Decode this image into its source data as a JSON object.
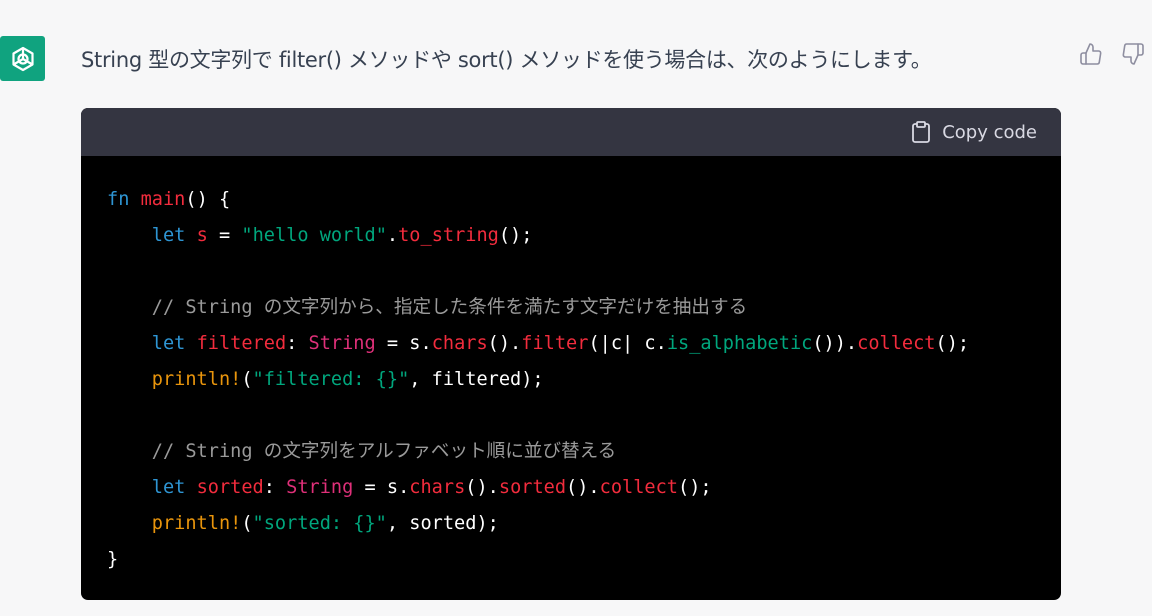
{
  "message": {
    "text": "String 型の文字列で filter() メソッドや sort() メソッドを使う場合は、次のようにします。"
  },
  "feedback": {
    "thumbs_up": "thumbs-up-icon",
    "thumbs_down": "thumbs-down-icon"
  },
  "code_block": {
    "copy_label": "Copy code",
    "lines": {
      "l1_kw": "fn",
      "l1_name": "main",
      "l1_rest": "() {",
      "l2_kw": "let",
      "l2_var": "s",
      "l2_eq": " = ",
      "l2_str": "\"hello world\"",
      "l2_dot": ".",
      "l2_call": "to_string",
      "l2_end": "();",
      "l4_comment": "// String の文字列から、指定した条件を満たす文字だけを抽出する",
      "l5_kw": "let",
      "l5_var": "filtered",
      "l5_colon": ": ",
      "l5_type": "String",
      "l5_eq": " = s.",
      "l5_m1": "chars",
      "l5_p1": "().",
      "l5_m2": "filter",
      "l5_p2": "(|c| c.",
      "l5_m3": "is_alphabetic",
      "l5_p3": "()).",
      "l5_m4": "collect",
      "l5_end": "();",
      "l6_mac": "println!",
      "l6_p1": "(",
      "l6_str": "\"filtered: {}\"",
      "l6_end": ", filtered);",
      "l8_comment": "// String の文字列をアルファベット順に並び替える",
      "l9_kw": "let",
      "l9_var": "sorted",
      "l9_colon": ": ",
      "l9_type": "String",
      "l9_eq": " = s.",
      "l9_m1": "chars",
      "l9_p1": "().",
      "l9_m2": "sorted",
      "l9_p2": "().",
      "l9_m3": "collect",
      "l9_end": "();",
      "l10_mac": "println!",
      "l10_p1": "(",
      "l10_str": "\"sorted: {}\"",
      "l10_end": ", sorted);",
      "l11": "}"
    }
  }
}
